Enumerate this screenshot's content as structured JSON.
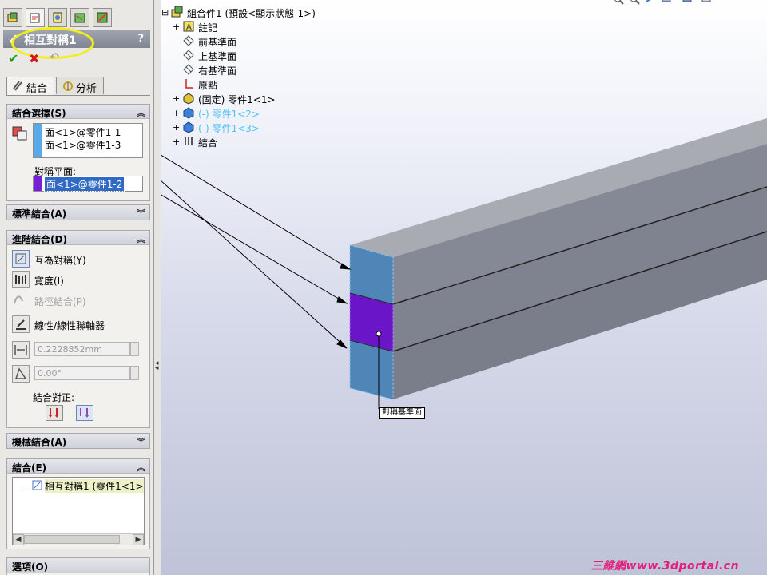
{
  "pm": {
    "title": "相互對稱1",
    "help": "?",
    "tabs": {
      "mates": "結合",
      "analysis": "分析"
    }
  },
  "selections": {
    "header": "結合選擇(S)",
    "entities": [
      "面<1>@零件1-1",
      "面<1>@零件1-3"
    ],
    "plane_label": "對稱平面:",
    "plane_value": "面<1>@零件1-2"
  },
  "standard": {
    "header": "標準結合(A)"
  },
  "advanced": {
    "header": "進階結合(D)",
    "items": [
      {
        "label": "互為對稱(Y)",
        "selected": true,
        "enabled": true
      },
      {
        "label": "寬度(I)",
        "selected": false,
        "enabled": true
      },
      {
        "label": "路徑結合(P)",
        "selected": false,
        "enabled": false
      },
      {
        "label": "線性/線性聯軸器",
        "selected": false,
        "enabled": true
      }
    ],
    "distance_value": "0.2228852mm",
    "angle_value": "0.00°",
    "alignment_label": "結合對正:"
  },
  "mechanical": {
    "header": "機械結合(A)"
  },
  "mates": {
    "header": "結合(E)",
    "items": [
      "相互對稱1 (零件1<1>"
    ]
  },
  "options": {
    "header": "選項(O)"
  },
  "tree": [
    {
      "label": "組合件1  (預設<顯示狀態-1>)",
      "expander": "⊟",
      "icon": "assembly",
      "color": "#000000"
    },
    {
      "label": "註記",
      "expander": "+",
      "icon": "annotation",
      "color": "#000000"
    },
    {
      "label": "前基準面",
      "expander": "",
      "icon": "plane",
      "color": "#000000"
    },
    {
      "label": "上基準面",
      "expander": "",
      "icon": "plane",
      "color": "#000000"
    },
    {
      "label": "右基準面",
      "expander": "",
      "icon": "plane",
      "color": "#000000"
    },
    {
      "label": "原點",
      "expander": "",
      "icon": "origin",
      "color": "#000000"
    },
    {
      "label": "(固定) 零件1<1>",
      "expander": "+",
      "icon": "part",
      "color": "#000000"
    },
    {
      "label": "(-) 零件1<2>",
      "expander": "+",
      "icon": "part-selected",
      "color": "#4fc3f7"
    },
    {
      "label": "(-) 零件1<3>",
      "expander": "+",
      "icon": "part-selected",
      "color": "#4fc3f7"
    },
    {
      "label": "結合",
      "expander": "+",
      "icon": "mates",
      "color": "#000000"
    }
  ],
  "callout": "對稱基準面",
  "watermark": "三維網www.3dportal.cn",
  "colors": {
    "entity_marker": "#5aa9e8",
    "plane_marker": "#7a1fd8",
    "highlight_face": "#5b9fd0",
    "plane_face": "#6a16c8",
    "title_circle": "#f2ee1a"
  }
}
